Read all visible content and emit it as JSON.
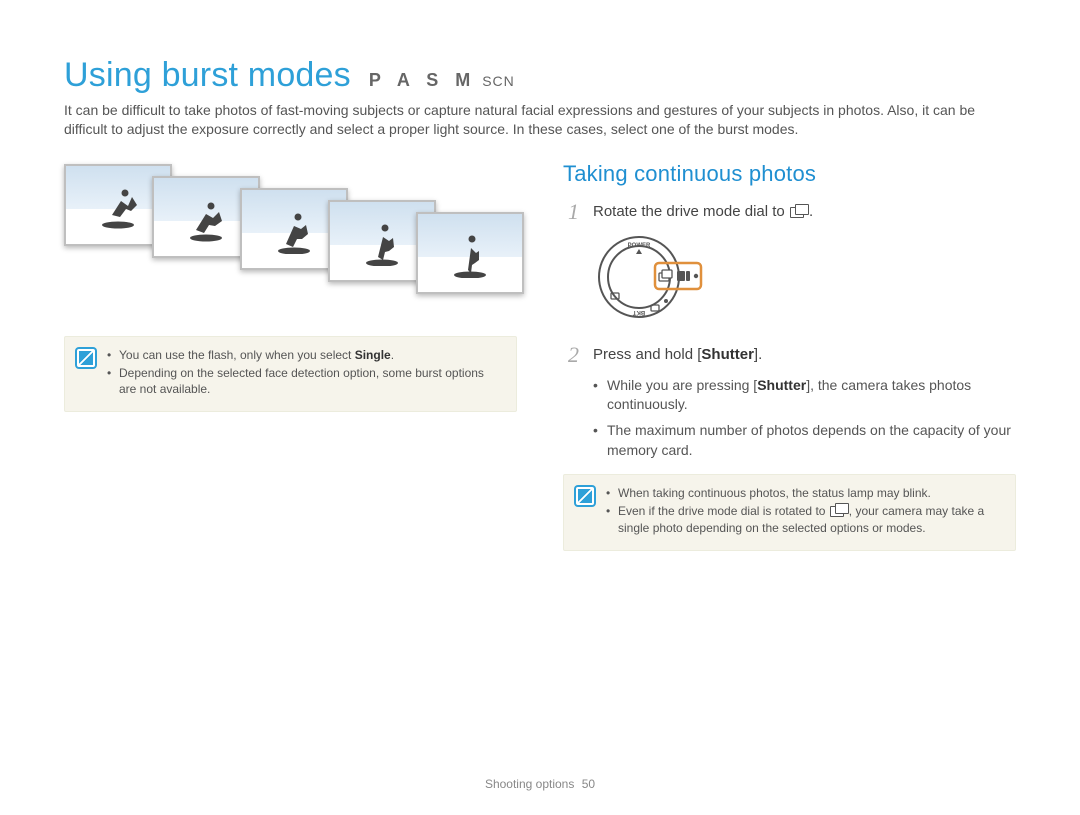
{
  "heading": {
    "title": "Using burst modes",
    "modes_large": "P A S M",
    "modes_small": "SCN"
  },
  "intro": "It can be difficult to take photos of fast-moving subjects or capture natural facial expressions and gestures of your subjects in photos. Also, it can be difficult to adjust the exposure correctly and select a proper light source. In these cases, select one of the burst modes.",
  "left_note": {
    "items": [
      {
        "pre": "You can use the flash, only when you select ",
        "bold": "Single",
        "post": "."
      },
      {
        "pre": "Depending on the selected face detection option, some burst options are not available.",
        "bold": "",
        "post": ""
      }
    ]
  },
  "right": {
    "section_title": "Taking continuous photos",
    "step1": {
      "num": "1",
      "pre": "Rotate the drive mode dial to ",
      "post": "."
    },
    "step2": {
      "num": "2",
      "pre": "Press and hold [",
      "bold": "Shutter",
      "post": "]."
    },
    "step2_sub": [
      {
        "pre": "While you are pressing [",
        "bold": "Shutter",
        "post": "], the camera takes photos continuously."
      },
      {
        "pre": "The maximum number of photos depends on the capacity of your memory card.",
        "bold": "",
        "post": ""
      }
    ],
    "note": {
      "items": [
        {
          "pre": "When taking continuous photos, the status lamp may blink.",
          "mid_icon": false,
          "post": ""
        },
        {
          "pre": "Even if the drive mode dial is rotated to ",
          "mid_icon": true,
          "post": ", your camera may take a single photo depending on the selected options or modes."
        }
      ]
    }
  },
  "footer": {
    "section": "Shooting options",
    "page": "50"
  }
}
